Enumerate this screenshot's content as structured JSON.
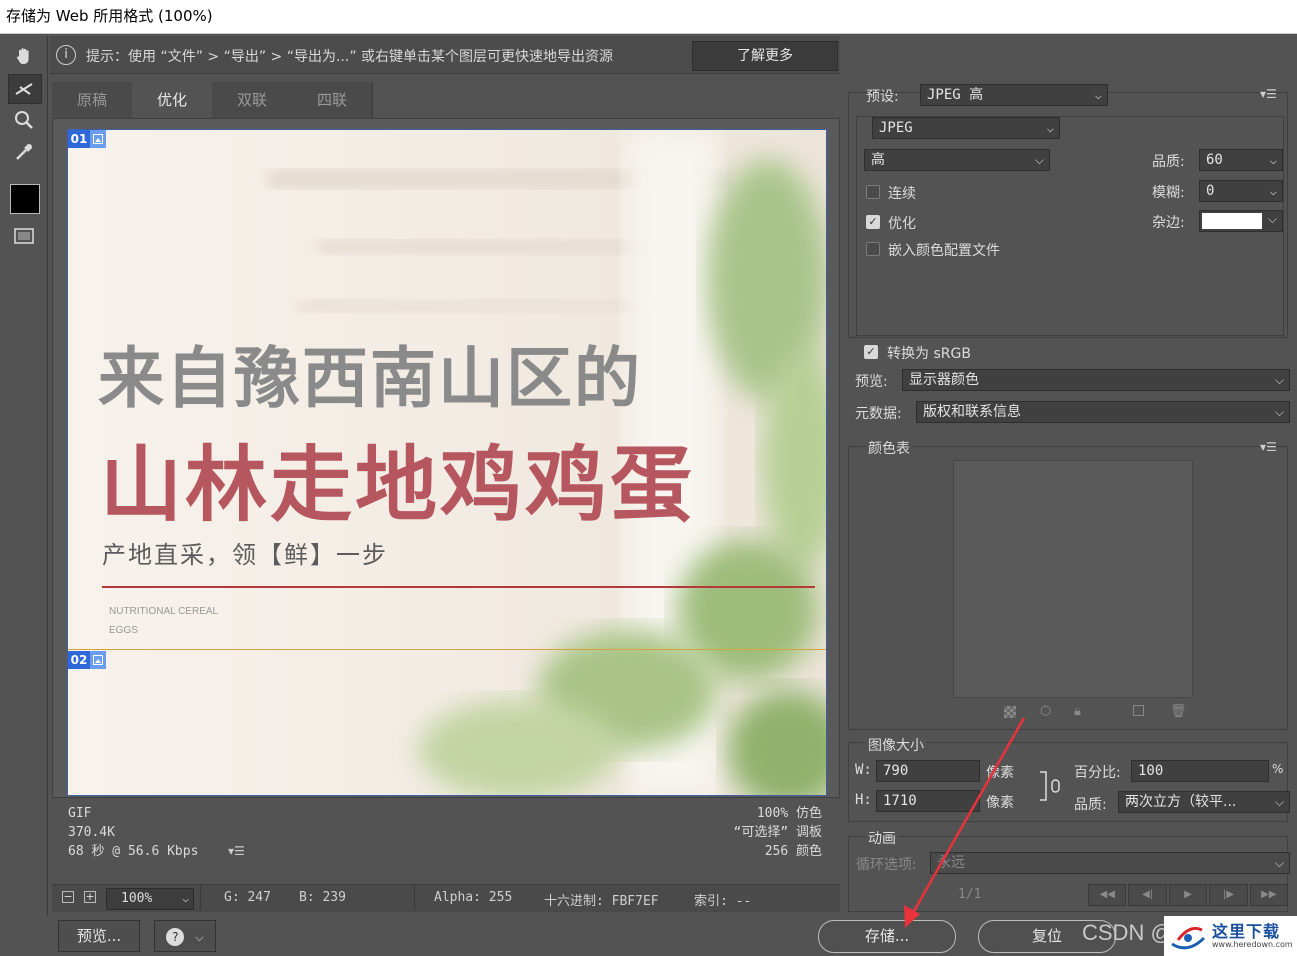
{
  "window": {
    "title": "存储为 Web 所用格式 (100%)"
  },
  "tools": [
    "hand-icon",
    "slice-select-icon",
    "zoom-icon",
    "eyedropper-icon",
    "color-swatch",
    "slice-visibility-icon"
  ],
  "hint": {
    "icon": "info-icon",
    "text": "提示：使用 “文件” > “导出” > “导出为...” 或右键单击某个图层可更快速地导出资源",
    "learn_more": "了解更多"
  },
  "tabs": [
    "原稿",
    "优化",
    "双联",
    "四联"
  ],
  "active_tab": "优化",
  "preview": {
    "slice1": "01",
    "slice2": "02",
    "headline1": "来自豫西南山区的",
    "headline2": "山林走地鸡鸡蛋",
    "subline": "产地直采，领【鲜】一步",
    "eng1": "NUTRITIONAL CEREAL",
    "eng2": "EGGS"
  },
  "info": {
    "format": "GIF",
    "size": "370.4K",
    "time": "68 秒 @ 56.6 Kbps",
    "dither": "100% 仿色",
    "palette": "“可选择” 调板",
    "colors": "256 颜色"
  },
  "statusbar": {
    "zoom": "100%",
    "g": "G: 247",
    "b": "B: 239",
    "alpha": "Alpha: 255",
    "hex": "十六进制: FBF7EF",
    "index": "索引: --"
  },
  "buttons": {
    "preview": "预览...",
    "save": "存储...",
    "reset": "复位"
  },
  "settings": {
    "preset_label": "预设:",
    "preset_value": "JPEG 高",
    "format_value": "JPEG",
    "quality_level": "高",
    "quality_label": "品质:",
    "quality_value": "60",
    "blur_label": "模糊:",
    "blur_value": "0",
    "matte_label": "杂边:",
    "progressive_label": "连续",
    "progressive_checked": false,
    "optimized_label": "优化",
    "optimized_checked": true,
    "embed_profile_label": "嵌入颜色配置文件",
    "embed_profile_checked": false,
    "srgb_label": "转换为 sRGB",
    "srgb_checked": true,
    "preview_label": "预览:",
    "preview_value": "显示器颜色",
    "metadata_label": "元数据:",
    "metadata_value": "版权和联系信息"
  },
  "color_table": {
    "title": "颜色表"
  },
  "image_size": {
    "title": "图像大小",
    "w_label": "W:",
    "w_value": "790",
    "h_label": "H:",
    "h_value": "1710",
    "unit": "像素",
    "percent_label": "百分比:",
    "percent_value": "100",
    "percent_unit": "%",
    "quality_label": "品质:",
    "quality_value": "两次立方（较平..."
  },
  "animation": {
    "title": "动画",
    "loop_label": "循环选项:",
    "loop_value": "永远",
    "frame": "1/1"
  },
  "watermarks": {
    "csdn": "CSDN @",
    "site_name": "这里下载",
    "site_url": "www.heredown.com"
  },
  "colors": {
    "accent_arrow": "#e8323c",
    "headline_red": "#b6565f",
    "slice_blue": "#2f68d8"
  }
}
